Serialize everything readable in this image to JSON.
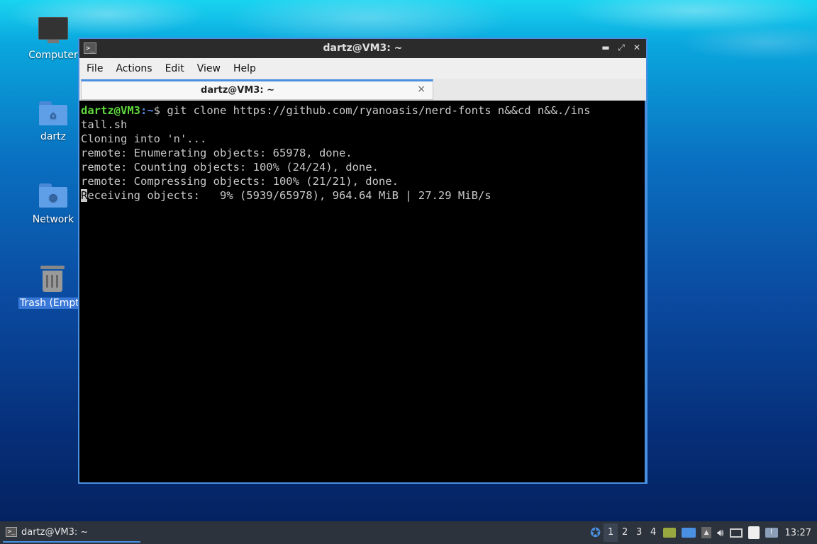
{
  "desktop": {
    "icons": [
      {
        "label": "Computer",
        "icon": "computer-icon"
      },
      {
        "label": "dartz",
        "icon": "home-folder-icon"
      },
      {
        "label": "Network",
        "icon": "network-folder-icon"
      },
      {
        "label": "Trash (Empt",
        "icon": "trash-icon"
      }
    ]
  },
  "window": {
    "title": "dartz@VM3: ~",
    "menu": [
      "File",
      "Actions",
      "Edit",
      "View",
      "Help"
    ],
    "tab_label": "dartz@VM3: ~",
    "tab_close": "×",
    "controls": {
      "minimize": "▬",
      "maximize": "⤢",
      "close": "✕"
    }
  },
  "terminal": {
    "prompt_user": "dartz@VM3",
    "prompt_path": ":~",
    "prompt_symbol": "$ ",
    "command_line1": "git clone https://github.com/ryanoasis/nerd-fonts n&&cd n&&./ins",
    "command_line2": "tall.sh",
    "output": [
      "Cloning into 'n'...",
      "remote: Enumerating objects: 65978, done.",
      "remote: Counting objects: 100% (24/24), done.",
      "remote: Compressing objects: 100% (21/21), done."
    ],
    "progress_cursor_char": "R",
    "progress_rest": "eceiving objects:   9% (5939/65978), 964.64 MiB | 27.29 MiB/s"
  },
  "taskbar": {
    "task_label": "dartz@VM3: ~",
    "workspaces": [
      "1",
      "2",
      "3",
      "4"
    ],
    "active_workspace": "1",
    "clock": "13:27"
  },
  "colors": {
    "accent": "#4a90e2",
    "prompt_user": "#5fd93c",
    "prompt_path": "#5c8ee6",
    "taskbar_bg": "#2c333d"
  }
}
